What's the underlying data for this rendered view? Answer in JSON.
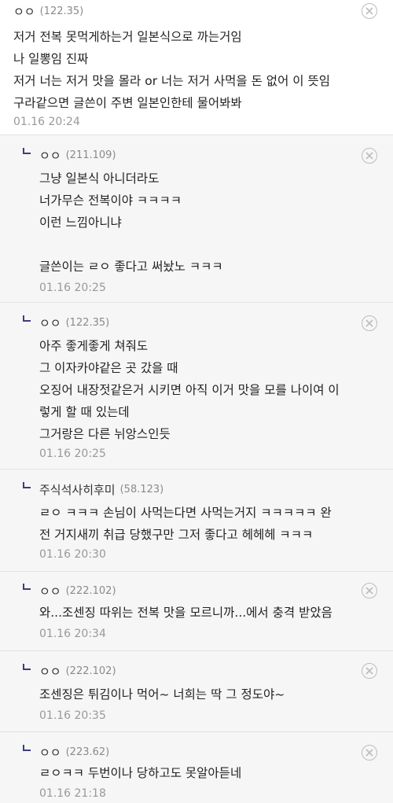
{
  "comments": [
    {
      "nick": "ㅇㅇ",
      "ip": "(122.35)",
      "lines": [
        "저거 전복 못먹게하는거 일본식으로 까는거임",
        "나 일뽕임 진짜",
        "저거 너는 저거 맛을 몰라 or 너는 저거 사먹을 돈 없어 이 뜻임",
        "구라같으면 글쓴이 주변 일본인한테 물어봐봐"
      ],
      "date": "01.16 20:24"
    },
    {
      "nick": "ㅇㅇ",
      "ip": "(211.109)",
      "lines": [
        "그냥 일본식 아니더라도",
        "너가무슨 전복이야 ㅋㅋㅋㅋ",
        "이런 느낌아니냐",
        "",
        "글쓴이는 ㄹㅇ 좋다고 써놨노 ㅋㅋㅋ"
      ],
      "date": "01.16 20:25"
    },
    {
      "nick": "ㅇㅇ",
      "ip": "(122.35)",
      "lines": [
        "아주 좋게좋게 쳐줘도",
        "그 이자카야같은 곳 갔을 때",
        "오징어 내장젓같은거 시키면 아직 이거 맛을 모를 나이여 이",
        "렇게 할 때 있는데",
        "그거랑은 다른 뉘앙스인듯"
      ],
      "date": "01.16 20:25"
    },
    {
      "nick": "주식석사히후미",
      "ip": "(58.123)",
      "lines": [
        "ㄹㅇ ㅋㅋㅋ 손님이 사먹는다면 사먹는거지 ㅋㅋㅋㅋㅋ 완",
        "전 거지새끼 취급 당했구만 그저 좋다고 헤헤헤 ㅋㅋㅋ"
      ],
      "date": "01.16 20:30"
    },
    {
      "nick": "ㅇㅇ",
      "ip": "(222.102)",
      "lines": [
        "와...조센징 따위는 전복 맛을 모르니까...에서 충격 받았음"
      ],
      "date": "01.16 20:34"
    },
    {
      "nick": "ㅇㅇ",
      "ip": "(222.102)",
      "lines": [
        "조센징은 튀김이나 먹어~ 너희는 딱 그 정도야~"
      ],
      "date": "01.16 20:35"
    },
    {
      "nick": "ㅇㅇ",
      "ip": "(223.62)",
      "lines": [
        "ㄹㅇㅋㅋ 두번이나 당하고도 못알아듣네"
      ],
      "date": "01.16 21:18"
    }
  ],
  "icons": {
    "reply": "reply-arrow-icon",
    "delete": "delete-x-icon"
  },
  "colors": {
    "reply_bg": "#f6f6f6",
    "ip": "#8a8a8a",
    "date": "#999999",
    "reply_arrow": "#3d3d7e"
  }
}
